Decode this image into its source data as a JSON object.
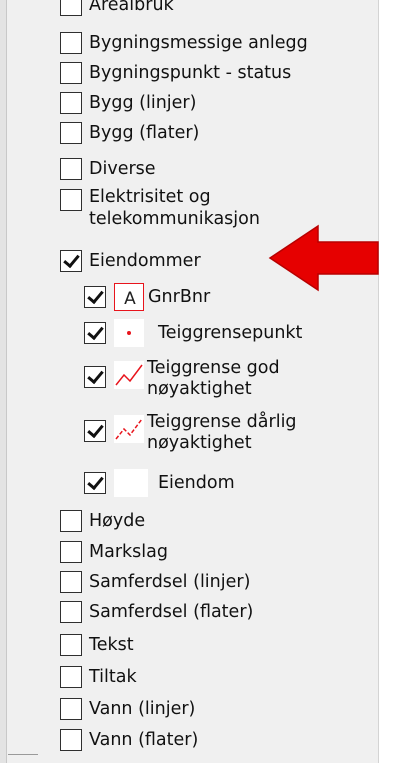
{
  "layer_tree": {
    "top_items": [
      {
        "label": "Arealbruk",
        "checked": false
      },
      {
        "label": "Bygningsmessige anlegg",
        "checked": false
      },
      {
        "label": "Bygningspunkt - status",
        "checked": false
      },
      {
        "label": "Bygg (linjer)",
        "checked": false
      },
      {
        "label": "Bygg (flater)",
        "checked": false
      },
      {
        "label": "Diverse",
        "checked": false
      },
      {
        "label": "Elektrisitet og telekommunikasjon",
        "checked": false
      }
    ],
    "group": {
      "label": "Eiendommer",
      "checked": true,
      "children": [
        {
          "label": "GnrBnr",
          "checked": true,
          "symbol": "text-A-icon"
        },
        {
          "label": "Teiggrensepunkt",
          "checked": true,
          "symbol": "red-point-icon"
        },
        {
          "label": "Teiggrense god nøyaktighet",
          "checked": true,
          "symbol": "red-solid-line-icon"
        },
        {
          "label": "Teiggrense dårlig nøyaktighet",
          "checked": true,
          "symbol": "red-dashed-line-icon"
        },
        {
          "label": "Eiendom",
          "checked": true,
          "symbol": "blank-fill-icon"
        }
      ]
    },
    "bottom_items": [
      {
        "label": "Høyde",
        "checked": false
      },
      {
        "label": "Markslag",
        "checked": false
      },
      {
        "label": "Samferdsel (linjer)",
        "checked": false
      },
      {
        "label": "Samferdsel (flater)",
        "checked": false
      },
      {
        "label": "Tekst",
        "checked": false
      },
      {
        "label": "Tiltak",
        "checked": false
      },
      {
        "label": "Vann (linjer)",
        "checked": false
      },
      {
        "label": "Vann (flater)",
        "checked": false
      }
    ]
  },
  "annotation": {
    "arrow_icon": "red-arrow-left-icon",
    "arrow_color": "#e60000"
  },
  "colors": {
    "symbol_red": "#e8141c"
  }
}
